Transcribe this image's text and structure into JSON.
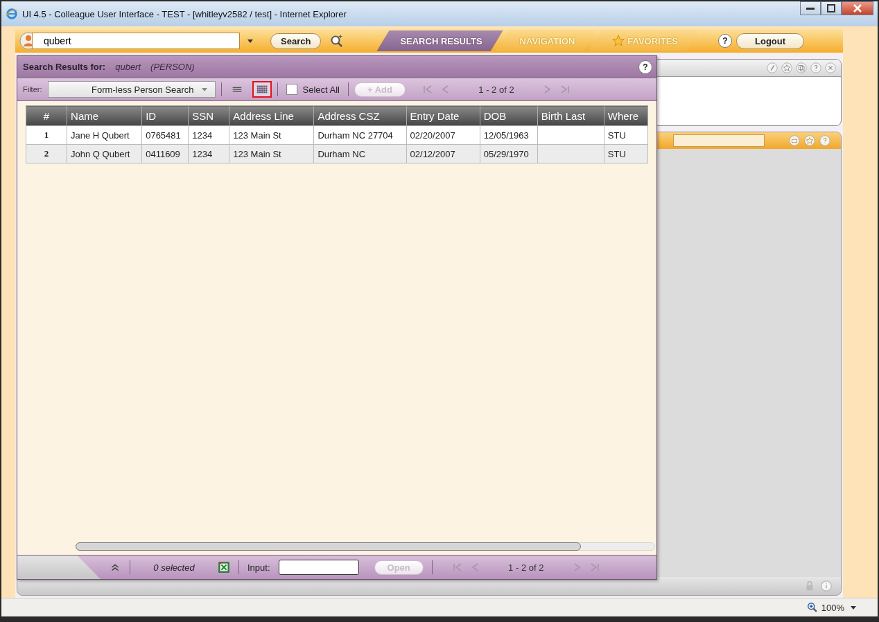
{
  "window": {
    "title": "UI 4.5 - Colleague User Interface - TEST - [whitleyv2582 / test] - Internet Explorer"
  },
  "toolbar": {
    "search_value": "qubert",
    "search_button": "Search",
    "help": "?",
    "logout": "Logout",
    "tabs": [
      {
        "label": "SEARCH RESULTS",
        "selected": true
      },
      {
        "label": "NAVIGATION",
        "selected": false
      },
      {
        "label": "FAVORITES",
        "selected": false
      }
    ]
  },
  "results": {
    "heading": "Search Results for:",
    "query": "qubert",
    "type": "(PERSON)",
    "help": "?",
    "filter_label": "Filter:",
    "filter_value": "Form-less Person Search",
    "views": [
      {
        "kind": "list",
        "selected": false
      },
      {
        "kind": "grid",
        "selected": true
      }
    ],
    "select_all": {
      "label": "Select All",
      "checked": false
    },
    "add_button": {
      "label": "+ Add",
      "disabled": true
    },
    "pager": "1 - 2 of 2",
    "table": {
      "columns": [
        "#",
        "Name",
        "ID",
        "SSN",
        "Address Line",
        "Address CSZ",
        "Entry Date",
        "DOB",
        "Birth Last",
        "Where"
      ],
      "rows": [
        [
          "1",
          "Jane H Qubert",
          "0765481",
          "1234",
          "123 Main St",
          "Durham NC 27704",
          "02/20/2007",
          "12/05/1963",
          "",
          "STU"
        ],
        [
          "2",
          "John Q Qubert",
          "0411609",
          "1234",
          "123 Main St",
          "Durham NC",
          "02/12/2007",
          "05/29/1970",
          "",
          "STU"
        ]
      ]
    },
    "footer": {
      "selected_count": "0 selected",
      "input_label": "Input:",
      "open_button": {
        "label": "Open",
        "disabled": true
      },
      "pager": "1 - 2 of 2"
    }
  },
  "status_bar": {
    "zoom": "100%"
  }
}
